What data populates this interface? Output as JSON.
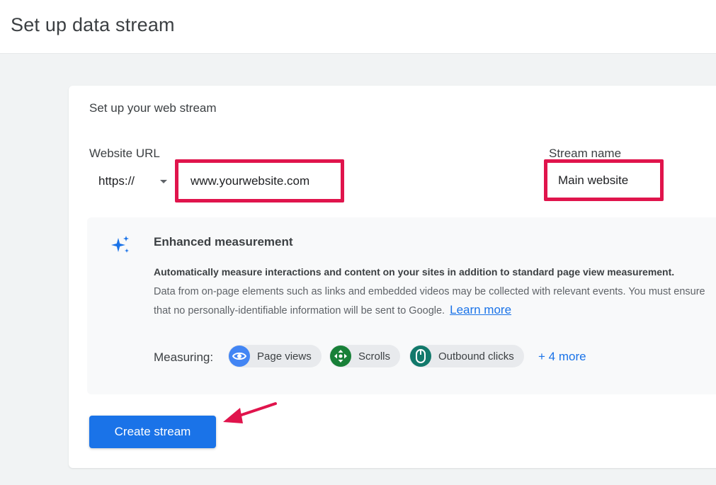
{
  "page": {
    "title": "Set up data stream"
  },
  "card": {
    "heading": "Set up your web stream",
    "website_url": {
      "label": "Website URL",
      "protocol": "https://",
      "value": "www.yourwebsite.com"
    },
    "stream_name": {
      "label": "Stream name",
      "value": "Main website"
    },
    "enhanced_measurement": {
      "icon": "sparkle-icon",
      "title": "Enhanced measurement",
      "description_bold": "Automatically measure interactions and content on your sites in addition to standard page view measurement.",
      "description": "Data from on-page elements such as links and embedded videos may be collected with relevant events. You must ensure that no personally-identifiable information will be sent to Google.",
      "learn_more": "Learn more",
      "measuring_label": "Measuring:",
      "chips": [
        {
          "label": "Page views",
          "icon": "eye-icon",
          "color": "#4285f4"
        },
        {
          "label": "Scrolls",
          "icon": "scroll-arrows-icon",
          "color": "#188038"
        },
        {
          "label": "Outbound clicks",
          "icon": "mouse-icon",
          "color": "#12796b"
        }
      ],
      "more_link": "+ 4 more"
    },
    "create_button": "Create stream"
  },
  "colors": {
    "accent": "#1a73e8",
    "highlight_border": "#e0144c",
    "annotation_arrow": "#e0144c"
  }
}
